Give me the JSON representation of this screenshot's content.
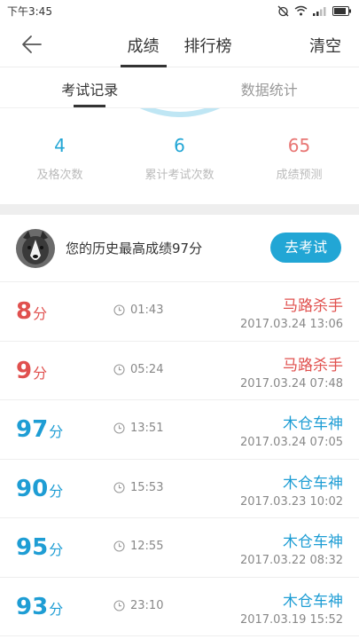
{
  "status_bar": {
    "time": "下午3:45"
  },
  "nav": {
    "tabs": [
      {
        "label": "成绩",
        "active": true
      },
      {
        "label": "排行榜",
        "active": false
      }
    ],
    "clear_label": "清空"
  },
  "sub_tabs": [
    {
      "label": "考试记录",
      "active": true
    },
    {
      "label": "数据统计",
      "active": false
    }
  ],
  "stats": [
    {
      "value": "4",
      "label": "及格次数"
    },
    {
      "value": "6",
      "label": "累计考试次数"
    },
    {
      "value": "65",
      "label": "成绩预测"
    }
  ],
  "best": {
    "text": "您的历史最高成绩97分",
    "button_label": "去考试"
  },
  "score_unit": "分",
  "records": [
    {
      "score": "8",
      "duration": "01:43",
      "rank": "马路杀手",
      "time": "2017.03.24  13:06",
      "status": "fail"
    },
    {
      "score": "9",
      "duration": "05:24",
      "rank": "马路杀手",
      "time": "2017.03.24  07:48",
      "status": "fail"
    },
    {
      "score": "97",
      "duration": "13:51",
      "rank": "木仓车神",
      "time": "2017.03.24  07:05",
      "status": "pass"
    },
    {
      "score": "90",
      "duration": "15:53",
      "rank": "木仓车神",
      "time": "2017.03.23  10:02",
      "status": "pass"
    },
    {
      "score": "95",
      "duration": "12:55",
      "rank": "木仓车神",
      "time": "2017.03.22  08:32",
      "status": "pass"
    },
    {
      "score": "93",
      "duration": "23:10",
      "rank": "木仓车神",
      "time": "2017.03.19  15:52",
      "status": "pass"
    }
  ],
  "colors": {
    "accent": "#22a6d5",
    "pass": "#1e9dd4",
    "fail": "#e0504e",
    "predict": "#e87674"
  }
}
